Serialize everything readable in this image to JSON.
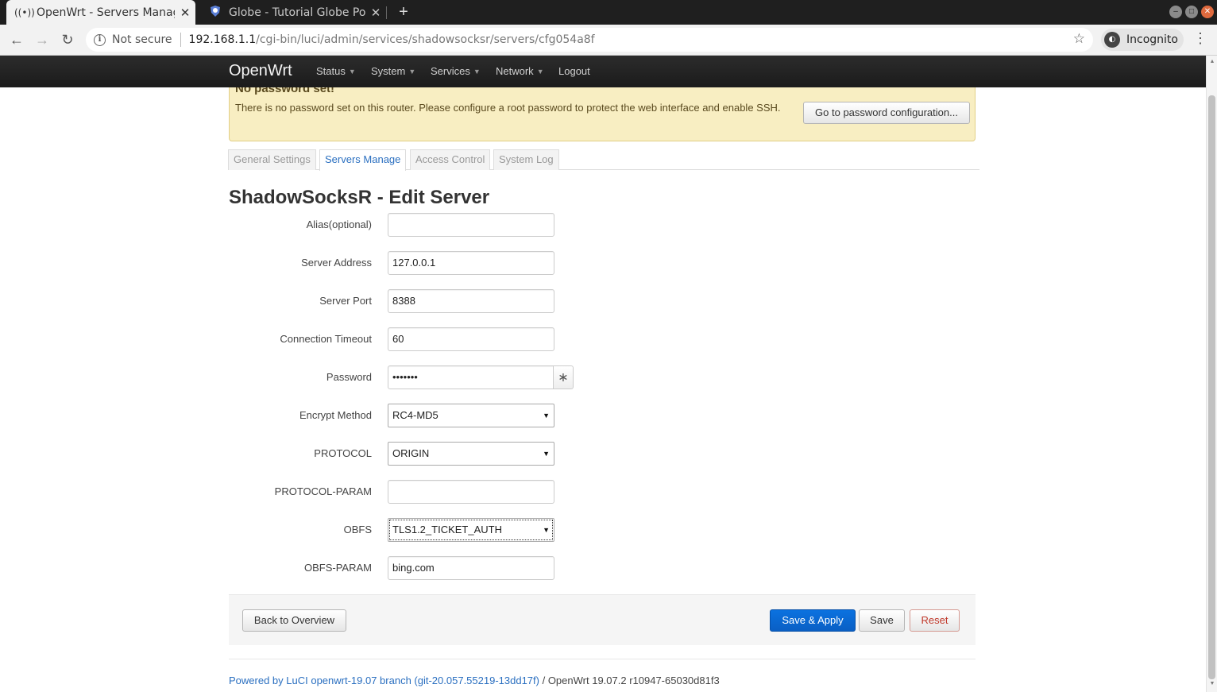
{
  "browser": {
    "tabs": [
      {
        "title": "OpenWrt - Servers Manag",
        "favicon": "broadcast-icon",
        "active": true
      },
      {
        "title": "Globe - Tutorial Globe Po",
        "favicon": "shield-icon",
        "active": false
      }
    ],
    "new_tab": "+",
    "url": {
      "security_label": "Not secure",
      "host": "192.168.1.1",
      "path": "/cgi-bin/luci/admin/services/shadowsocksr/servers/cfg054a8f"
    },
    "incognito_label": "Incognito"
  },
  "navbar": {
    "brand": "OpenWrt",
    "items": [
      {
        "label": "Status",
        "dropdown": true
      },
      {
        "label": "System",
        "dropdown": true
      },
      {
        "label": "Services",
        "dropdown": true
      },
      {
        "label": "Network",
        "dropdown": true
      },
      {
        "label": "Logout",
        "dropdown": false
      }
    ]
  },
  "alert": {
    "title": "No password set!",
    "text": "There is no password set on this router. Please configure a root password to protect the web interface and enable SSH.",
    "button": "Go to password configuration..."
  },
  "tabs": [
    {
      "label": "General Settings",
      "active": false
    },
    {
      "label": "Servers Manage",
      "active": true
    },
    {
      "label": "Access Control",
      "active": false
    },
    {
      "label": "System Log",
      "active": false
    }
  ],
  "section_title": "ShadowSocksR - Edit Server",
  "fields": {
    "alias": {
      "label": "Alias(optional)",
      "value": ""
    },
    "server_address": {
      "label": "Server Address",
      "value": "127.0.0.1"
    },
    "server_port": {
      "label": "Server Port",
      "value": "8388"
    },
    "timeout": {
      "label": "Connection Timeout",
      "value": "60"
    },
    "password": {
      "label": "Password",
      "value": "•••••••",
      "reveal": "∗"
    },
    "encrypt_method": {
      "label": "Encrypt Method",
      "value": "RC4-MD5"
    },
    "protocol": {
      "label": "PROTOCOL",
      "value": "ORIGIN"
    },
    "protocol_param": {
      "label": "PROTOCOL-PARAM",
      "value": ""
    },
    "obfs": {
      "label": "OBFS",
      "value": "TLS1.2_TICKET_AUTH"
    },
    "obfs_param": {
      "label": "OBFS-PARAM",
      "value": "bing.com"
    }
  },
  "actions": {
    "back": "Back to Overview",
    "save_apply": "Save & Apply",
    "save": "Save",
    "reset": "Reset"
  },
  "footer": {
    "link": "Powered by LuCI openwrt-19.07 branch (git-20.057.55219-13dd17f)",
    "text": " / OpenWrt 19.07.2 r10947-65030d81f3"
  },
  "colors": {
    "navbar": "#222222",
    "alert_bg": "#f8eec2",
    "primary": "#0a68d6",
    "link": "#2a6fc0",
    "reset": "#c0392b"
  }
}
